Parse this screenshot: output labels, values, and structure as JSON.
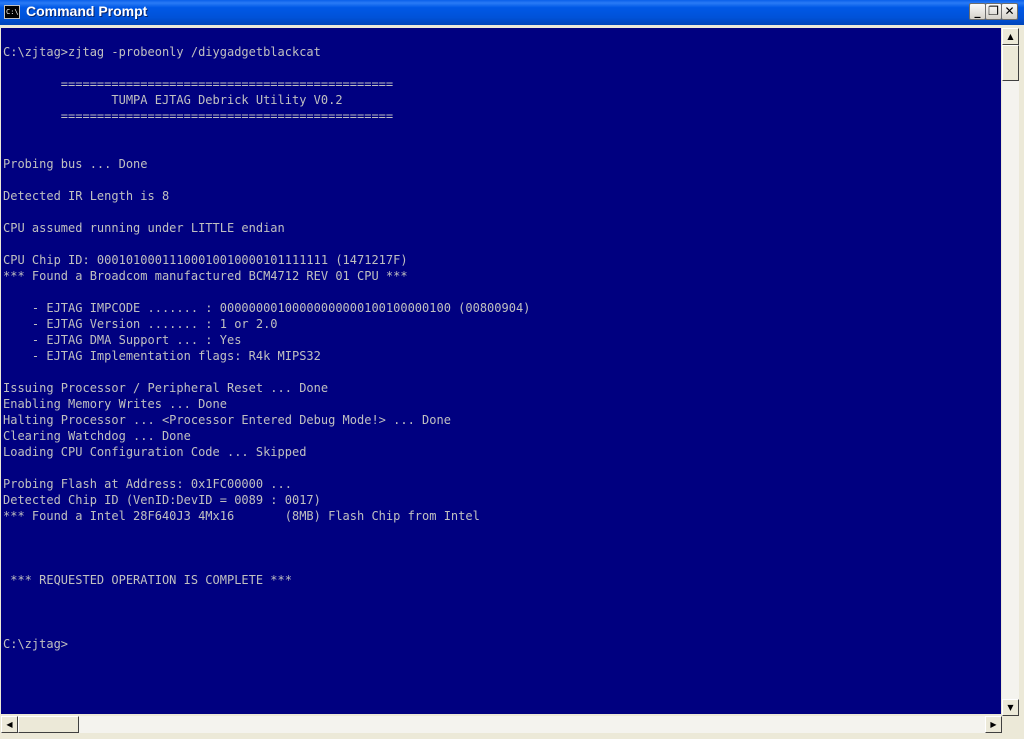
{
  "window": {
    "title": "Command Prompt",
    "icon_text": "C:\\",
    "minimize": "_",
    "restore": "❐",
    "close": "✕"
  },
  "console": {
    "background": "#000080",
    "foreground": "#C0C0C0",
    "lines": [
      "C:\\zjtag>zjtag -probeonly /diygadgetblackcat",
      "",
      "        ==============================================",
      "               TUMPA EJTAG Debrick Utility V0.2",
      "        ==============================================",
      "",
      "",
      "Probing bus ... Done",
      "",
      "Detected IR Length is 8",
      "",
      "CPU assumed running under LITTLE endian",
      "",
      "CPU Chip ID: 00010100011100010010000101111111 (1471217F)",
      "*** Found a Broadcom manufactured BCM4712 REV 01 CPU ***",
      "",
      "    - EJTAG IMPCODE ....... : 00000000100000000000100100000100 (00800904)",
      "    - EJTAG Version ....... : 1 or 2.0",
      "    - EJTAG DMA Support ... : Yes",
      "    - EJTAG Implementation flags: R4k MIPS32",
      "",
      "Issuing Processor / Peripheral Reset ... Done",
      "Enabling Memory Writes ... Done",
      "Halting Processor ... <Processor Entered Debug Mode!> ... Done",
      "Clearing Watchdog ... Done",
      "Loading CPU Configuration Code ... Skipped",
      "",
      "Probing Flash at Address: 0x1FC00000 ...",
      "Detected Chip ID (VenID:DevID = 0089 : 0017)",
      "*** Found a Intel 28F640J3 4Mx16       (8MB) Flash Chip from Intel",
      "",
      "",
      "",
      " *** REQUESTED OPERATION IS COMPLETE ***",
      "",
      "",
      "",
      "C:\\zjtag>"
    ]
  },
  "scrollbars": {
    "up_arrow": "▲",
    "down_arrow": "▼",
    "left_arrow": "◀",
    "right_arrow": "▶"
  }
}
